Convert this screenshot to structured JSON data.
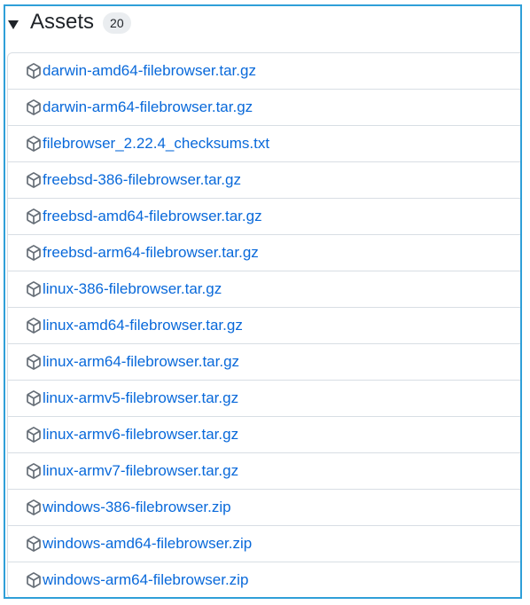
{
  "assets": {
    "title": "Assets",
    "count": "20",
    "icon": "package-icon",
    "link_color": "#0969da",
    "files": [
      "darwin-amd64-filebrowser.tar.gz",
      "darwin-arm64-filebrowser.tar.gz",
      "filebrowser_2.22.4_checksums.txt",
      "freebsd-386-filebrowser.tar.gz",
      "freebsd-amd64-filebrowser.tar.gz",
      "freebsd-arm64-filebrowser.tar.gz",
      "linux-386-filebrowser.tar.gz",
      "linux-amd64-filebrowser.tar.gz",
      "linux-arm64-filebrowser.tar.gz",
      "linux-armv5-filebrowser.tar.gz",
      "linux-armv6-filebrowser.tar.gz",
      "linux-armv7-filebrowser.tar.gz",
      "windows-386-filebrowser.zip",
      "windows-amd64-filebrowser.zip",
      "windows-arm64-filebrowser.zip"
    ]
  }
}
